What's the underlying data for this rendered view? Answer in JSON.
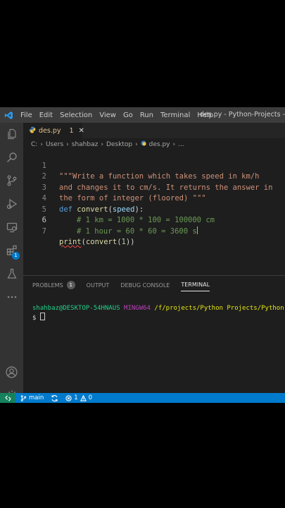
{
  "window": {
    "title": "des.py - Python-Projects -"
  },
  "menu": {
    "items": [
      "File",
      "Edit",
      "Selection",
      "View",
      "Go",
      "Run",
      "Terminal",
      "Help"
    ]
  },
  "activity": {
    "extensions_badge": "1"
  },
  "tab": {
    "filename": "des.py",
    "problem_count": "1",
    "close": "✕"
  },
  "breadcrumb": {
    "parts": [
      "C:",
      "Users",
      "shahbaz",
      "Desktop",
      "des.py",
      "..."
    ]
  },
  "editor": {
    "lines": [
      {
        "n": "1",
        "text": "\"\"\"Write a function which takes speed in km/h"
      },
      {
        "n": "2",
        "text": "and changes it to cm/s. It returns the answer in"
      },
      {
        "n": "3",
        "text": "the form of integer (floored) \"\"\""
      },
      {
        "n": "4",
        "kw": "def",
        "fn": "convert",
        "param": "speed",
        "colon": "):"
      },
      {
        "n": "5",
        "text": "# 1 km = 1000 * 100 = 100000 cm"
      },
      {
        "n": "6",
        "text": "# 1 hour = 60 * 60 = 3600 s"
      },
      {
        "n": "7",
        "fn1": "print",
        "fn2": "convert",
        "arg": "1",
        "close": "))"
      }
    ]
  },
  "panel": {
    "tabs": [
      "PROBLEMS",
      "OUTPUT",
      "DEBUG CONSOLE",
      "TERMINAL"
    ],
    "problems_badge": "1",
    "terminal": {
      "user": "shahbaz@DESKTOP-54HNAUS",
      "host": "MINGW64",
      "path": "/f/projects/Python Projects/Python-Pr",
      "prompt": "$"
    }
  },
  "status": {
    "branch": "main",
    "errors": "1",
    "warnings": "0"
  },
  "colors": {
    "status_bar": "#007acc",
    "remote": "#16825d",
    "editor_bg": "#1e1e1e"
  }
}
